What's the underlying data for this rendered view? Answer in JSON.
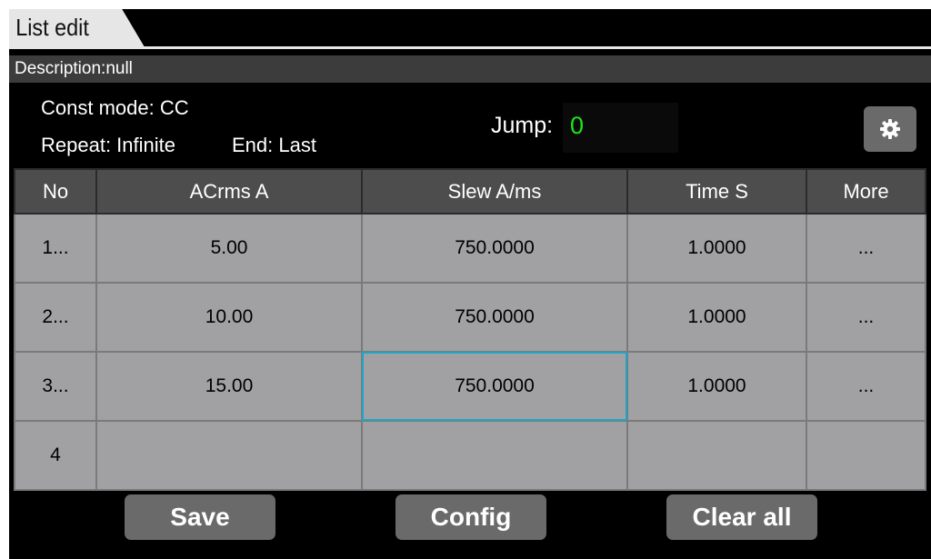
{
  "tab": {
    "title": "List edit"
  },
  "description": {
    "text": "Description:null"
  },
  "info": {
    "const_mode": "Const mode: CC",
    "repeat": "Repeat: Infinite",
    "end": "End: Last",
    "jump_label": "Jump:",
    "jump_value": "0"
  },
  "settings": {
    "icon": "gear-icon"
  },
  "table": {
    "headers": [
      "No",
      "ACrms A",
      "Slew A/ms",
      "Time S",
      "More"
    ],
    "rows": [
      [
        "1...",
        "5.00",
        "750.0000",
        "1.0000",
        "..."
      ],
      [
        "2...",
        "10.00",
        "750.0000",
        "1.0000",
        "..."
      ],
      [
        "3...",
        "15.00",
        "750.0000",
        "1.0000",
        "..."
      ],
      [
        "4",
        "",
        "",
        "",
        ""
      ]
    ],
    "selected_cell": "row 3, Slew A/ms"
  },
  "buttons": {
    "save": "Save",
    "config": "Config",
    "clear_all": "Clear all"
  },
  "colors": {
    "background": "#000000",
    "cell_bg": "#a1a0a3",
    "header_bg": "#4d4d4d",
    "button_bg": "#6a6a6a",
    "jump_value": "#19e619",
    "selection": "#1fa6c7"
  }
}
